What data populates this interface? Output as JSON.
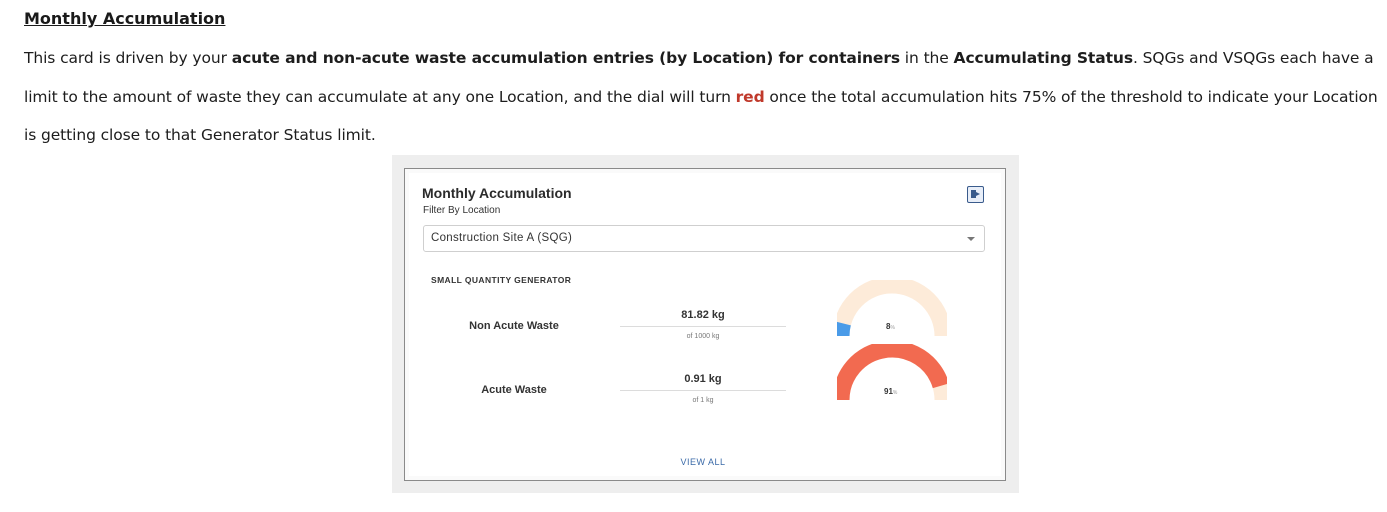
{
  "doc": {
    "title": "Monthly Accumulation",
    "paragraph": {
      "p1": "This card is driven by your ",
      "b1": "acute and non-acute waste accumulation entries (by Location) for containers",
      "p2": " in the ",
      "b2": "Accumulating Status",
      "p3": ". SQGs and VSQGs each have a limit to the amount of waste they can accumulate at any one Location, and the dial will turn ",
      "red": "red",
      "p4": " once the total accumulation hits 75% of the threshold to indicate your Location is getting close to that Generator Status limit."
    }
  },
  "card": {
    "title": "Monthly Accumulation",
    "filter_label": "Filter By Location",
    "export_icon": "export-icon",
    "location_value": "Construction Site A (SQG)",
    "section_label": "SMALL QUANTITY GENERATOR",
    "rows": [
      {
        "label": "Non Acute Waste",
        "amount": "81.82 kg",
        "limit": "of 1000 kg",
        "percent_text": "8",
        "percent_unit": "%",
        "fraction": 0.08,
        "fill_color": "#4a9be8"
      },
      {
        "label": "Acute Waste",
        "amount": "0.91 kg",
        "limit": "of 1 kg",
        "percent_text": "91",
        "percent_unit": "%",
        "fraction": 0.91,
        "fill_color": "#f26a50"
      }
    ],
    "gauge_track_color": "#fdebd9",
    "view_all": "VIEW ALL"
  }
}
